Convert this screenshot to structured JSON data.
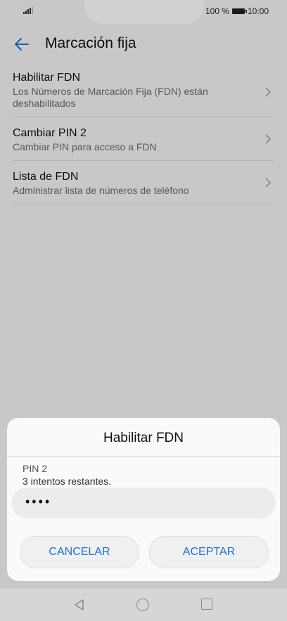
{
  "status_bar": {
    "battery_text": "100 %",
    "time": "10:00"
  },
  "app_bar": {
    "title": "Marcación fija",
    "back_icon": "arrow-left-icon"
  },
  "list": {
    "items": [
      {
        "title": "Habilitar FDN",
        "subtitle": "Los Números de Marcación Fija (FDN) están deshabilitados"
      },
      {
        "title": "Cambiar PIN 2",
        "subtitle": "Cambiar PIN para acceso a FDN"
      },
      {
        "title": "Lista de FDN",
        "subtitle": "Administrar lista de números de teléfono"
      }
    ]
  },
  "dialog": {
    "title": "Habilitar FDN",
    "field_label": "PIN 2",
    "hint": "3 intentos restantes.",
    "pin_value": "••••",
    "cancel_label": "CANCELAR",
    "accept_label": "ACEPTAR"
  },
  "colors": {
    "accent": "#1a73d9"
  }
}
